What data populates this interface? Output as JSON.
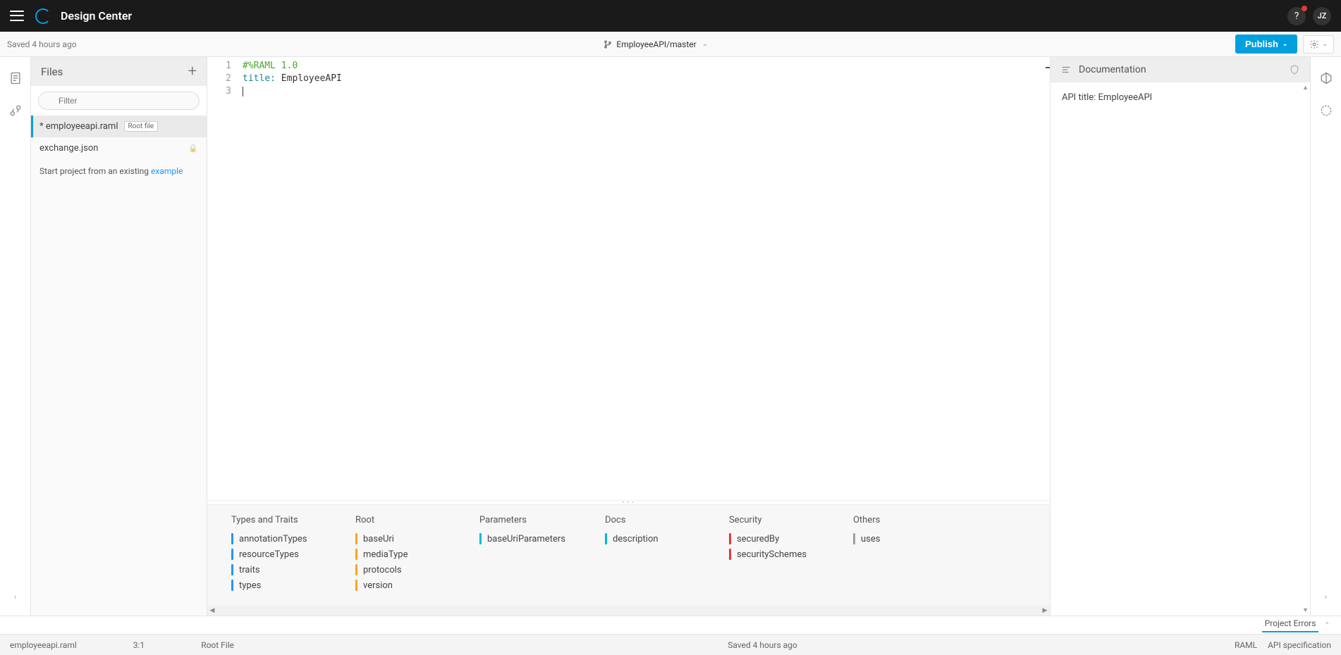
{
  "header": {
    "app_title": "Design Center",
    "help_label": "?",
    "user_initials": "JZ"
  },
  "subheader": {
    "saved_text": "Saved 4 hours ago",
    "breadcrumb": "EmployeeAPI/master",
    "publish_label": "Publish"
  },
  "files": {
    "panel_title": "Files",
    "filter_placeholder": "Filter",
    "items": [
      {
        "name": "* employeeapi.raml",
        "badge": "Root file",
        "active": true
      },
      {
        "name": "exchange.json",
        "locked": true
      }
    ],
    "example_prefix": "Start project from an existing ",
    "example_link": "example"
  },
  "editor": {
    "lines": [
      {
        "n": "1",
        "raw": "#%RAML 1.0",
        "cls": "kw"
      },
      {
        "n": "2",
        "key": "title:",
        "val": " EmployeeAPI"
      },
      {
        "n": "3",
        "raw": "",
        "cursor": true
      }
    ]
  },
  "suggestions": {
    "columns": [
      {
        "title": "Types and Traits",
        "color": "bar-blue",
        "items": [
          "annotationTypes",
          "resourceTypes",
          "traits",
          "types"
        ]
      },
      {
        "title": "Root",
        "color": "bar-orange",
        "items": [
          "baseUri",
          "mediaType",
          "protocols",
          "version"
        ]
      },
      {
        "title": "Parameters",
        "color": "bar-teal",
        "items": [
          "baseUriParameters"
        ]
      },
      {
        "title": "Docs",
        "color": "bar-teal",
        "items": [
          "description"
        ]
      },
      {
        "title": "Security",
        "color": "bar-red",
        "items": [
          "securedBy",
          "securitySchemes"
        ]
      },
      {
        "title": "Others",
        "color": "bar-gray",
        "items": [
          "uses"
        ]
      }
    ]
  },
  "docs": {
    "panel_title": "Documentation",
    "content": "API title: EmployeeAPI"
  },
  "errors": {
    "tab_label": "Project Errors"
  },
  "status": {
    "file": "employeeapi.raml",
    "cursor": "3:1",
    "role": "Root File",
    "saved": "Saved 4 hours ago",
    "lang": "RAML",
    "spec": "API specification"
  }
}
